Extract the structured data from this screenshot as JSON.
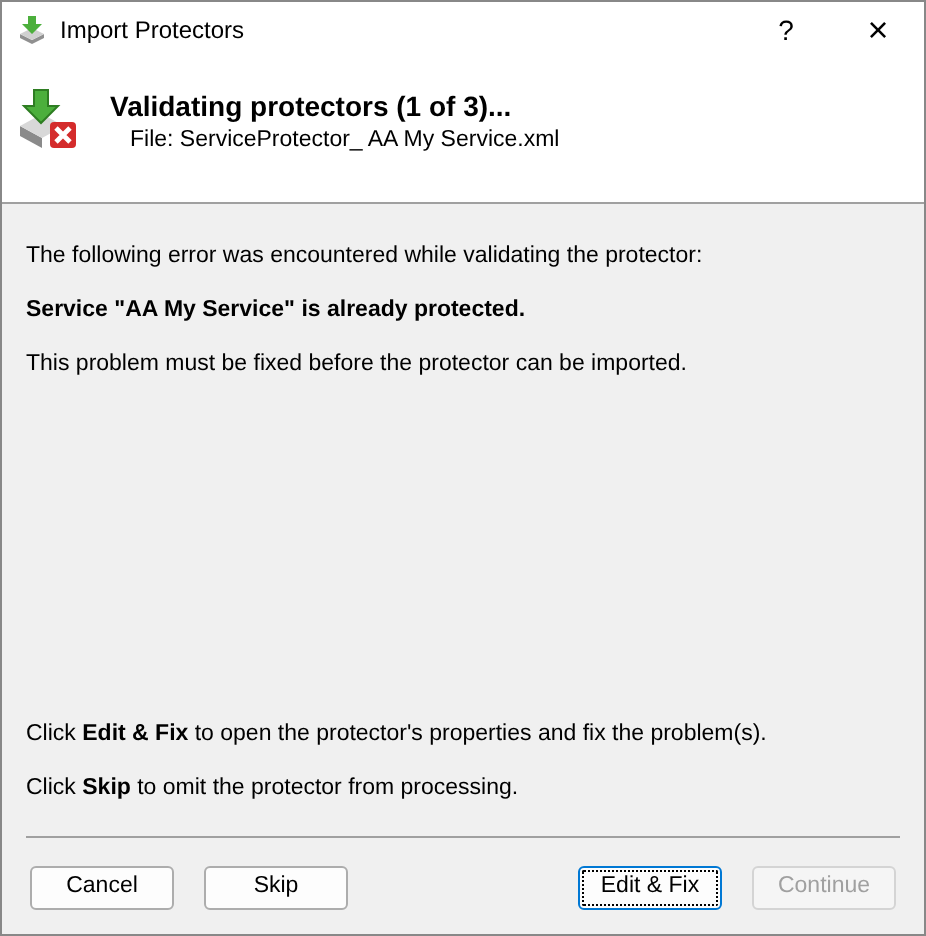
{
  "window": {
    "title": "Import Protectors",
    "help": "?",
    "close": "×"
  },
  "header": {
    "title": "Validating protectors (1 of 3)...",
    "subtitle": "File: ServiceProtector_ AA My Service.xml"
  },
  "messages": [
    {
      "text": "The following error was encountered while validating the protector:",
      "bold": false
    },
    {
      "text": "Service \"AA My Service\" is already protected.",
      "bold": true
    },
    {
      "text": "This problem must be fixed before the protector can be imported.",
      "bold": false
    }
  ],
  "instructions": [
    "Click **Edit & Fix** to open the protector's properties and fix the problem(s).",
    "Click **Skip** to omit the protector from processing."
  ],
  "left_buttons": [
    {
      "label": "Cancel",
      "disabled": false,
      "focused": false
    },
    {
      "label": "Skip",
      "disabled": false,
      "focused": false
    }
  ],
  "right_buttons": [
    {
      "label": "Edit & Fix",
      "disabled": false,
      "focused": true
    },
    {
      "label": "Continue",
      "disabled": true,
      "focused": false
    }
  ]
}
